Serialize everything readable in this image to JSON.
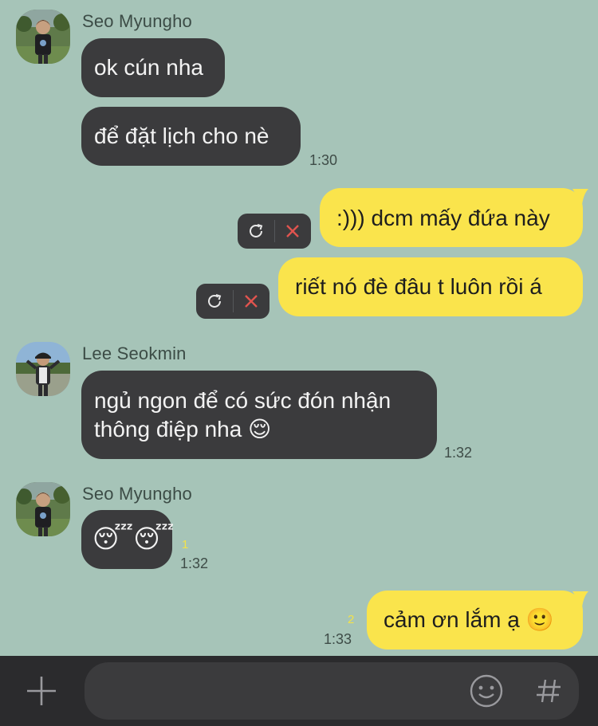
{
  "messages": {
    "m1": {
      "sender": "Seo Myungho",
      "line1": "ok cún nha",
      "line2": "để đặt lịch cho nè",
      "time": "1:30"
    },
    "m2": {
      "line1": ":))) dcm mấy đứa này",
      "line2": "riết nó đè đâu t luôn rồi á"
    },
    "m3": {
      "sender": "Lee Seokmin",
      "line1": "ngủ ngon để có sức đón nhận",
      "line2": "thông điệp nha 😌",
      "time": "1:32"
    },
    "m4": {
      "sender": "Seo Myungho",
      "text": "😴😴",
      "unread": "1",
      "time": "1:32"
    },
    "m5": {
      "text": "cảm ơn lắm ạ 🙂",
      "unread": "2",
      "time": "1:33"
    }
  },
  "icons": {
    "retry": "refresh-icon",
    "cancel": "close-icon",
    "attach": "plus-icon",
    "emoji": "emoji-icon",
    "hashtag": "hash-icon"
  },
  "colors": {
    "background": "#a6c4b8",
    "incoming": "#3b3b3d",
    "outgoing": "#fae44c",
    "cancel": "#e0544f",
    "unread": "#f2e24a"
  }
}
